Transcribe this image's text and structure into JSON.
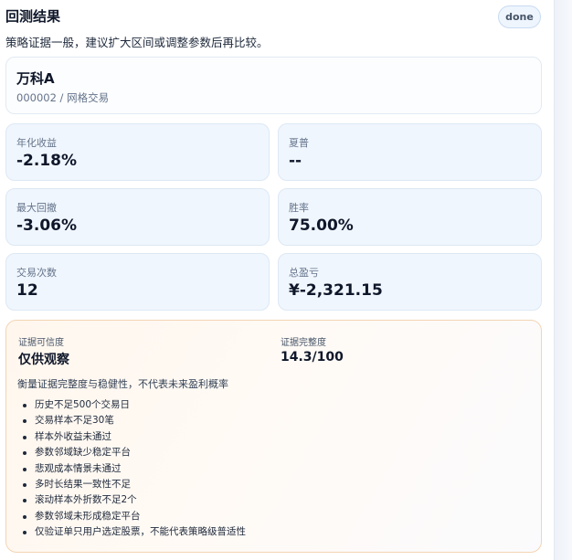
{
  "header": {
    "title": "回测结果",
    "status_badge": "done",
    "subtitle": "策略证据一般，建议扩大区间或调整参数后再比较。"
  },
  "stock": {
    "name": "万科A",
    "code_strategy": "000002 / 网格交易"
  },
  "metrics": [
    {
      "label": "年化收益",
      "value": "-2.18%"
    },
    {
      "label": "夏普",
      "value": "--"
    },
    {
      "label": "最大回撤",
      "value": "-3.06%"
    },
    {
      "label": "胜率",
      "value": "75.00%"
    },
    {
      "label": "交易次数",
      "value": "12"
    },
    {
      "label": "总盈亏",
      "value": "¥-2,321.15"
    }
  ],
  "evidence": {
    "confidence_label": "证据可信度",
    "confidence_value": "仅供观察",
    "completeness_label": "证据完整度",
    "completeness_value": "14.3/100",
    "description": "衡量证据完整度与稳健性，不代表未来盈利概率",
    "warnings": [
      "历史不足500个交易日",
      "交易样本不足30笔",
      "样本外收益未通过",
      "参数邻域缺少稳定平台",
      "悲观成本情景未通过",
      "多时长结果一致性不足",
      "滚动样本外折数不足2个",
      "参数邻域未形成稳定平台",
      "仅验证单只用户选定股票，不能代表策略级普适性"
    ]
  }
}
